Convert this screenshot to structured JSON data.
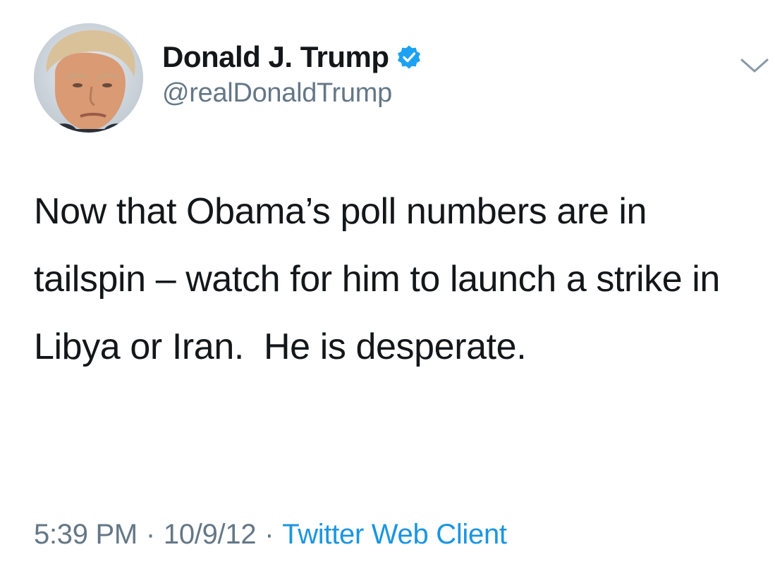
{
  "tweet": {
    "author": {
      "display_name": "Donald J. Trump",
      "handle": "@realDonaldTrump",
      "verified": true,
      "verified_icon": "verified-badge-icon"
    },
    "menu_icon": "chevron-down-icon",
    "text": "Now that Obama’s poll numbers are in tailspin – watch for him to launch a strike in Libya or Iran.  He is desperate.",
    "meta": {
      "time": "5:39 PM",
      "date": "10/9/12",
      "separator": "·",
      "source": "Twitter Web Client"
    },
    "colors": {
      "text": "#14171a",
      "secondary": "#657786",
      "link": "#1b95e0",
      "verified": "#1da1f2"
    }
  }
}
